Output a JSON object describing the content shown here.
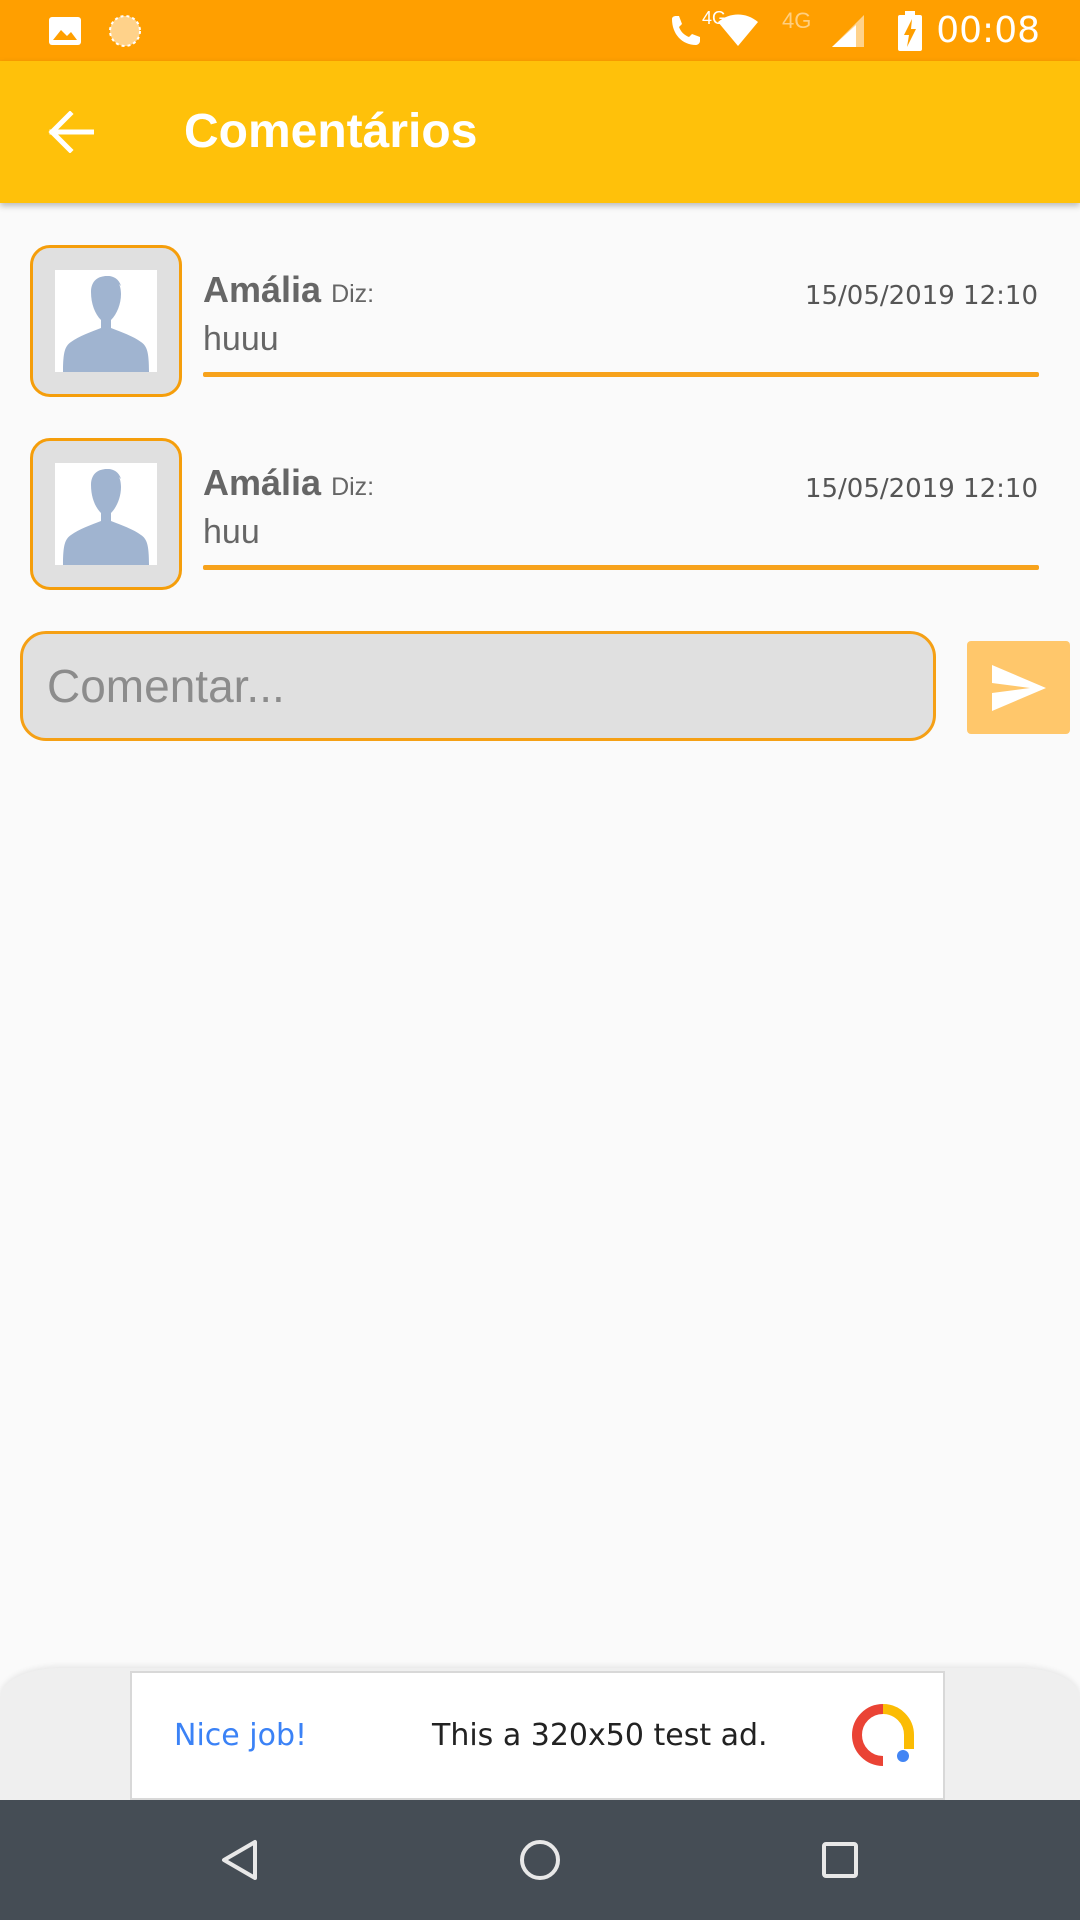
{
  "status_bar": {
    "time": "00:08",
    "network_label_1": "4G",
    "network_label_2": "4G",
    "background_color": "#ff9f00",
    "icons": [
      "image-icon",
      "sync-indicator-icon",
      "volte-call-icon",
      "wifi-icon",
      "cell-signal-icon",
      "battery-charging-icon"
    ]
  },
  "app_bar": {
    "title": "Comentários",
    "background_color": "#ffc10a",
    "back_icon": "arrow-left-icon"
  },
  "comments": [
    {
      "author": "Amália",
      "says": "Diz:",
      "timestamp": "15/05/2019 12:10",
      "text": "huuu"
    },
    {
      "author": "Amália",
      "says": "Diz:",
      "timestamp": "15/05/2019 12:10",
      "text": "huu"
    }
  ],
  "comment_input": {
    "placeholder": "Comentar...",
    "value": ""
  },
  "send_button": {
    "icon": "send-icon",
    "color": "#ffc76b"
  },
  "ad": {
    "nice": "Nice job!",
    "text": "This a 320x50 test ad."
  },
  "nav_bar": {
    "icons": [
      "back-triangle-icon",
      "home-circle-icon",
      "recents-square-icon"
    ]
  },
  "accent_color": "#f59e0b"
}
